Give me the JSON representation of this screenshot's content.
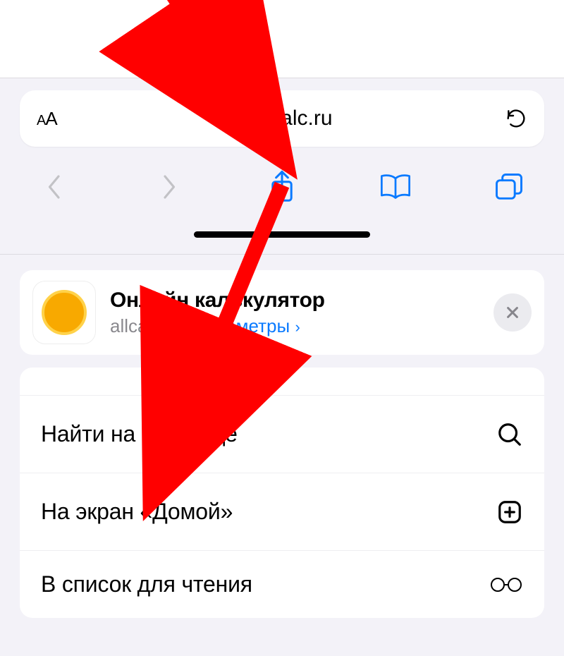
{
  "safari": {
    "aa_small": "A",
    "aa_big": "A",
    "url": "allcalc.ru"
  },
  "share": {
    "title": "Онлайн калькулятор",
    "domain": "allcalc.ru",
    "options_label": "Параметры",
    "options_chevron": "›"
  },
  "actions": {
    "find": "Найти на странице",
    "home": "На экран «Домой»",
    "reading": "В список для чтения"
  }
}
